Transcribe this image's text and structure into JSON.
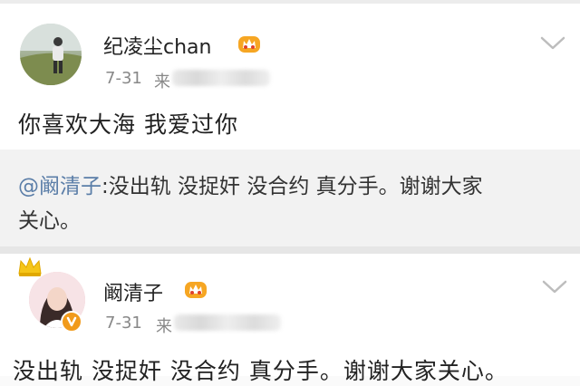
{
  "post1": {
    "username": "纪凌尘chan",
    "date": "7-31",
    "source_prefix": "来",
    "text": "你喜欢大海 我爱过你"
  },
  "repost": {
    "mention": "@阚清子",
    "line1_rest": ":没出轨 没捉奸 没合约 真分手。谢谢大家",
    "line2": "关心。"
  },
  "post2": {
    "username": "阚清子",
    "date": "7-31",
    "source_prefix": "来",
    "text": "没出轨 没捉奸 没合约 真分手。谢谢大家关心。"
  },
  "icons": [
    "vip-crown-icon",
    "chevron-down-icon",
    "verified-badge-icon"
  ],
  "colors": {
    "mention": "#5b7ea8",
    "badge": "#f19a1b",
    "repost_bg": "#f2f2f2"
  }
}
